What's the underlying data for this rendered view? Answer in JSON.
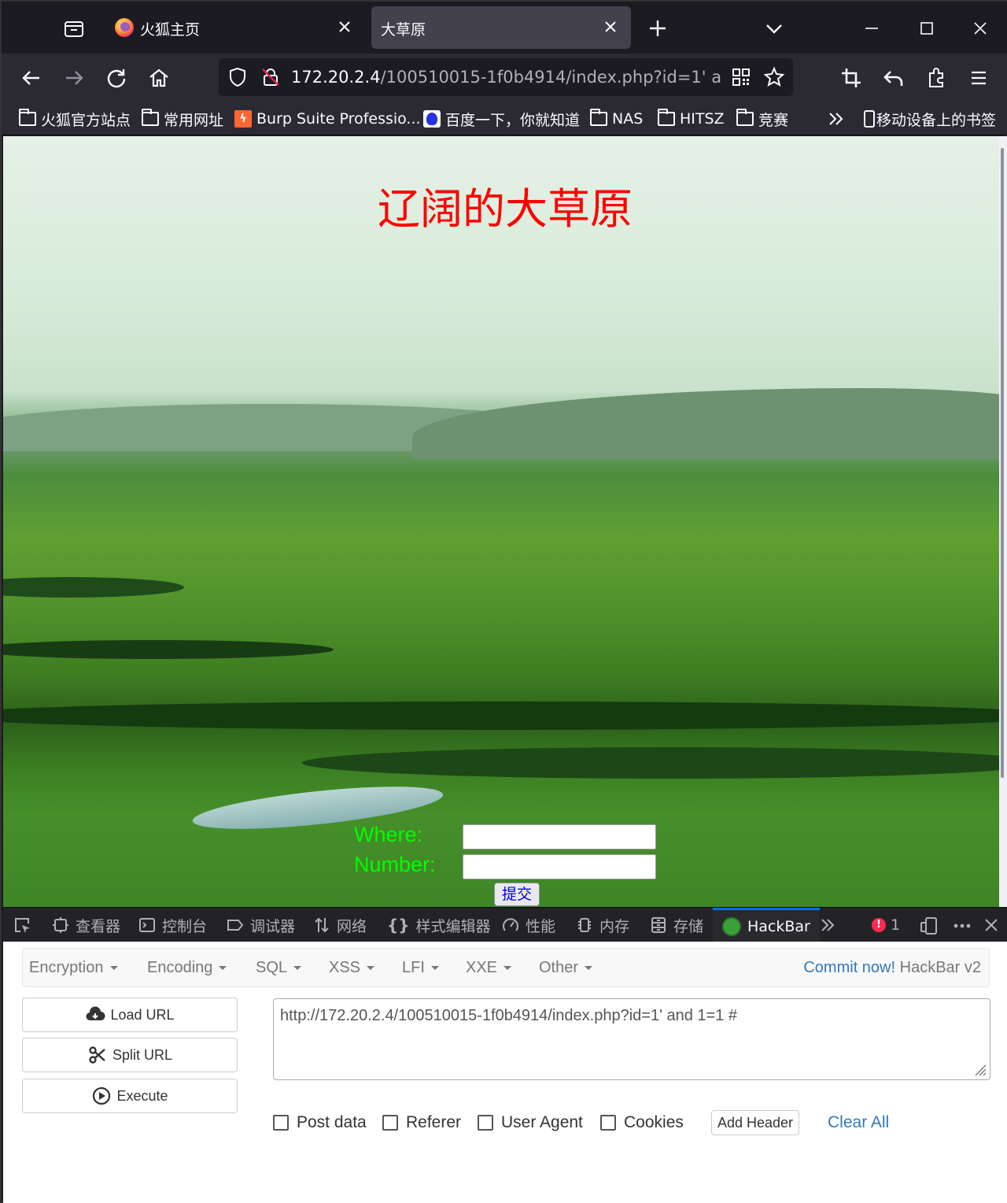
{
  "browser": {
    "tabs": [
      {
        "title": "火狐主页",
        "active": false
      },
      {
        "title": "大草原",
        "active": true
      }
    ],
    "url": {
      "host": "172.20.2.4",
      "path": "/100510015-1f0b4914/index.php?id=1' and 1=1 #"
    },
    "bookmarks": [
      {
        "label": "火狐官方站点",
        "icon": "folder-icon"
      },
      {
        "label": "常用网址",
        "icon": "folder-icon"
      },
      {
        "label": "Burp Suite Professio...",
        "icon": "burp-icon"
      },
      {
        "label": "百度一下，你就知道",
        "icon": "baidu-icon"
      },
      {
        "label": "NAS",
        "icon": "folder-icon"
      },
      {
        "label": "HITSZ",
        "icon": "folder-icon"
      },
      {
        "label": "竞赛",
        "icon": "folder-icon"
      }
    ],
    "mobile_bookmarks": "移动设备上的书签"
  },
  "page": {
    "title": "辽阔的大草原",
    "where_label": "Where:",
    "number_label": "Number:",
    "submit_label": "提交",
    "colors": {
      "title": "#ff0000",
      "labels": "#00ff00"
    }
  },
  "devtools": {
    "tabs": [
      {
        "label": "查看器",
        "icon": "inspector-icon"
      },
      {
        "label": "控制台",
        "icon": "console-icon"
      },
      {
        "label": "调试器",
        "icon": "debugger-icon"
      },
      {
        "label": "网络",
        "icon": "network-icon"
      },
      {
        "label": "样式编辑器",
        "icon": "style-editor-icon"
      },
      {
        "label": "性能",
        "icon": "performance-icon"
      },
      {
        "label": "内存",
        "icon": "memory-icon"
      },
      {
        "label": "存储",
        "icon": "storage-icon"
      },
      {
        "label": "HackBar",
        "icon": "hackbar-icon",
        "active": true
      }
    ],
    "error_count": "1"
  },
  "hackbar": {
    "menus": [
      "Encryption",
      "Encoding",
      "SQL",
      "XSS",
      "LFI",
      "XXE",
      "Other"
    ],
    "commit": "Commit now!",
    "brand": "HackBar v2",
    "buttons": {
      "load": "Load URL",
      "split": "Split URL",
      "execute": "Execute"
    },
    "url_value": "http://172.20.2.4/100510015-1f0b4914/index.php?id=1' and 1=1 #",
    "checkboxes": [
      "Post data",
      "Referer",
      "User Agent",
      "Cookies"
    ],
    "add_header": "Add Header",
    "clear_all": "Clear All"
  }
}
